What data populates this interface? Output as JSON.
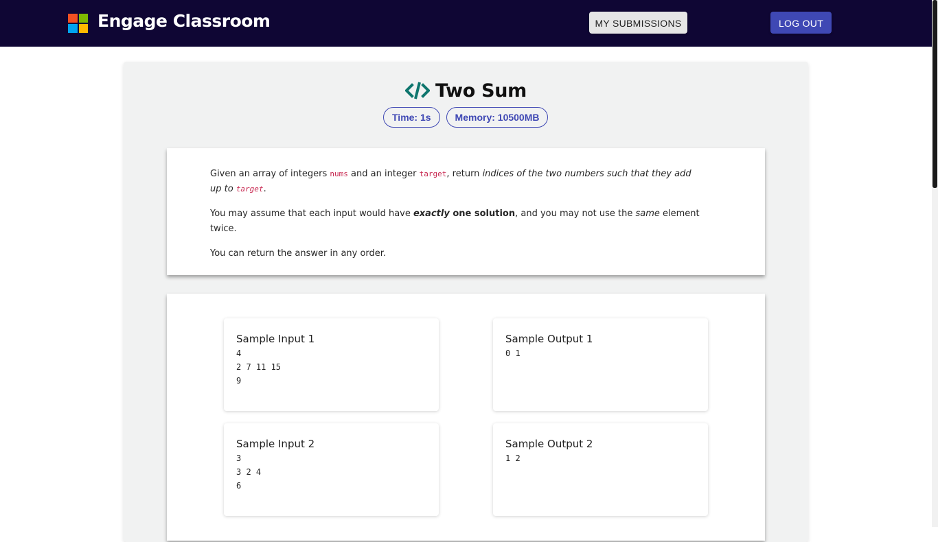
{
  "header": {
    "app_title": "Engage Classroom",
    "my_submissions_label": "MY SUBMISSIONS",
    "logout_label": "LOG OUT",
    "background_color": "#0f0634",
    "logo_colors": [
      "#f25022",
      "#7fba00",
      "#00a4ef",
      "#ffb900"
    ]
  },
  "problem": {
    "title": "Two Sum",
    "title_icon": "code-icon",
    "icon_color": "#0f766e",
    "time_limit": "Time: 1s",
    "memory_limit": "Memory: 10500MB",
    "description": {
      "p1_before_nums": "Given an array of integers ",
      "nums": "nums",
      "p1_between": " and an integer ",
      "target": "target",
      "p1_after_target": ", return ",
      "p1_italic": "indices of the two numbers such that they add up to ",
      "p1_end": ".",
      "p2_before": "You may assume that each input would have ",
      "p2_exactly": "exactly",
      "p2_one_solution": " one solution",
      "p2_middle": ", and you may not use the ",
      "p2_same": "same",
      "p2_end": " element twice.",
      "p3": "You can return the answer in any order."
    }
  },
  "samples": [
    {
      "input_title": "Sample Input 1",
      "input": "4\n2 7 11 15\n9",
      "output_title": "Sample Output 1",
      "output": "0 1"
    },
    {
      "input_title": "Sample Input 2",
      "input": "3\n3 2 4\n6",
      "output_title": "Sample Output 2",
      "output": "1 2"
    }
  ],
  "accent_color": "#3f48b4"
}
